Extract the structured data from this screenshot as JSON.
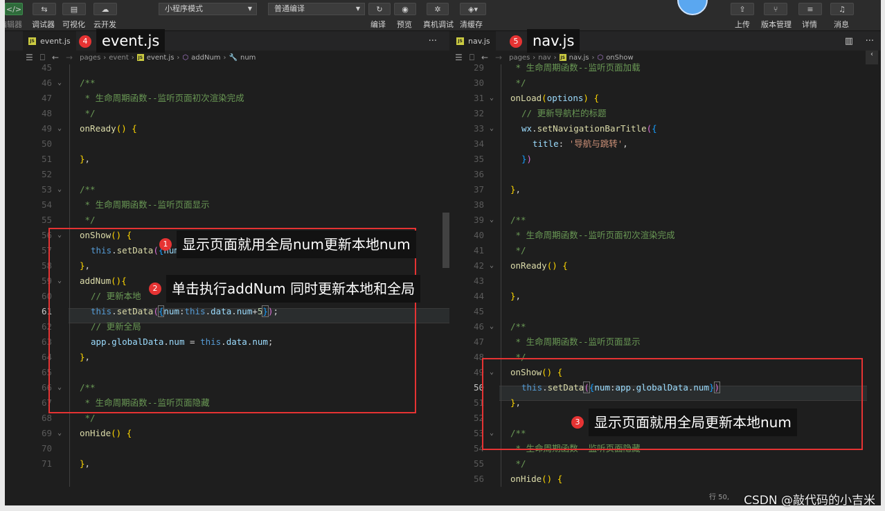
{
  "toolbar": {
    "left_labels": [
      "编辑器",
      "调试器",
      "可视化",
      "云开发"
    ],
    "mode_select": "小程序模式",
    "compile_select": "普通编译",
    "center_labels": [
      "编译",
      "预览",
      "真机调试",
      "清缓存"
    ],
    "right_labels": [
      "上传",
      "版本管理",
      "详情",
      "消息"
    ]
  },
  "left": {
    "tab": "event.js",
    "tab_more": "···",
    "breadcrumb": [
      "pages",
      "event",
      "event.js",
      "addNum",
      "num"
    ],
    "title_tag": "event.js",
    "title_badge": "4",
    "line_numbers": [
      "45",
      "46",
      "47",
      "48",
      "49",
      "50",
      "51",
      "52",
      "53",
      "54",
      "55",
      "56",
      "57",
      "58",
      "59",
      "60",
      "61",
      "62",
      "63",
      "64",
      "65",
      "66",
      "67",
      "68",
      "69",
      "70",
      "71"
    ],
    "cursor_line": "61"
  },
  "right": {
    "tab": "nav.js",
    "tab_more": "···",
    "breadcrumb": [
      "pages",
      "nav",
      "nav.js",
      "onShow"
    ],
    "title_tag": "nav.js",
    "title_badge": "5",
    "line_numbers": [
      "29",
      "30",
      "31",
      "32",
      "33",
      "34",
      "35",
      "36",
      "37",
      "38",
      "39",
      "40",
      "41",
      "42",
      "43",
      "44",
      "45",
      "46",
      "47",
      "48",
      "49",
      "50",
      "51",
      "52",
      "53",
      "54",
      "55",
      "56"
    ],
    "cursor_line": "50"
  },
  "annotations": {
    "a1": {
      "badge": "1",
      "text": "显示页面就用全局num更新本地num"
    },
    "a2": {
      "badge": "2",
      "text": "单击执行addNum 同时更新本地和全局"
    },
    "a3": {
      "badge": "3",
      "text": "显示页面就用全局更新本地num"
    }
  },
  "status": {
    "position": "行 50,",
    "watermark": "CSDN @敲代码的小吉米"
  }
}
